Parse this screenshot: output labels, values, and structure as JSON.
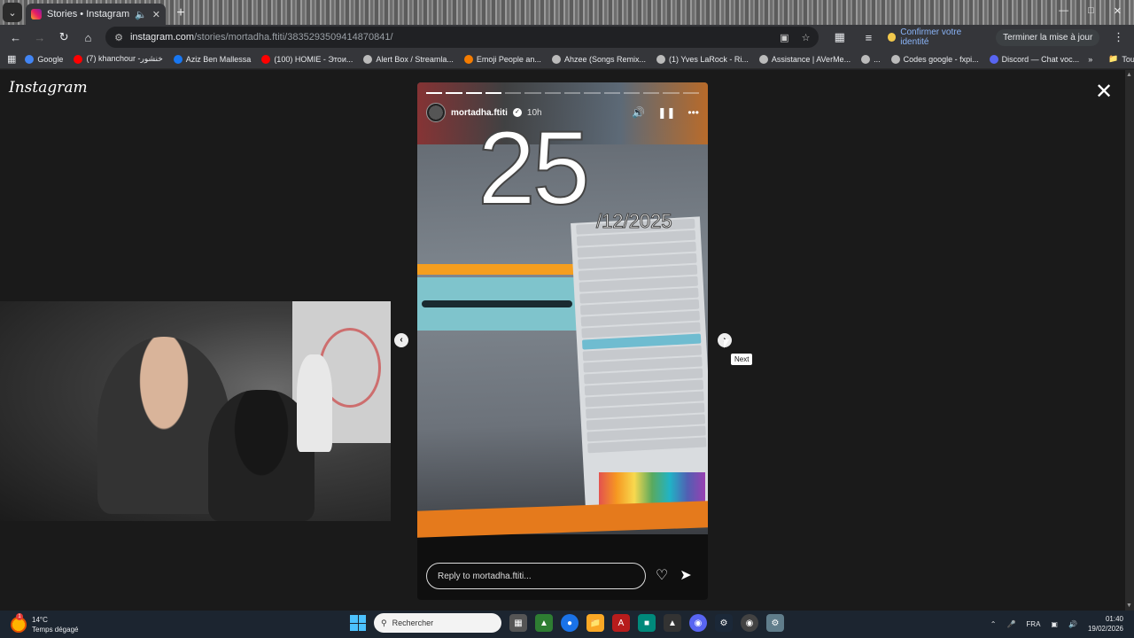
{
  "browser": {
    "tab_title": "Stories • Instagram",
    "url_host": "instagram.com",
    "url_path": "/stories/mortadha.ftiti/3835293509414870841/",
    "identity_label": "Confirmer votre identité",
    "update_label": "Terminer la mise à jour",
    "bookmarks": [
      {
        "label": "Google",
        "color": "#4285f4"
      },
      {
        "label": "(7) khanchour -خنشور",
        "color": "#ff0000"
      },
      {
        "label": "Aziz Ben Mallessa",
        "color": "#1877f2"
      },
      {
        "label": "(100) HOMIE - Этои...",
        "color": "#ff0000"
      },
      {
        "label": "Alert Box / Streamla...",
        "color": "#bbbbbb"
      },
      {
        "label": "Emoji People an...",
        "color": "#f57c00"
      },
      {
        "label": "Ahzee (Songs Remix...",
        "color": "#bbbbbb"
      },
      {
        "label": "(1) Yves LaRock - Ri...",
        "color": "#bbbbbb"
      },
      {
        "label": "Assistance | AVerMe...",
        "color": "#bbbbbb"
      },
      {
        "label": "...",
        "color": "#bbbbbb"
      },
      {
        "label": "Codes google - fxpi...",
        "color": "#bbbbbb"
      },
      {
        "label": "Discord — Chat voc...",
        "color": "#5865f2"
      }
    ],
    "all_bookmarks_label": "Tous les favoris"
  },
  "page": {
    "logo_text": "Instagram",
    "close_icon": "close-icon"
  },
  "story": {
    "username": "mortadha.ftiti",
    "age": "10h",
    "progress_total_segments": 14,
    "progress_completed_segments": 4,
    "big_day": "25",
    "date_rest": "/12/2025",
    "reply_placeholder": "Reply to mortadha.ftiti...",
    "next_tooltip": "Next"
  },
  "taskbar": {
    "weather_temp": "14°C",
    "weather_desc": "Temps dégagé",
    "weather_badge": "1",
    "search_placeholder": "Rechercher",
    "language": "FRA",
    "time": "01:40",
    "date": "19/02/2026"
  }
}
